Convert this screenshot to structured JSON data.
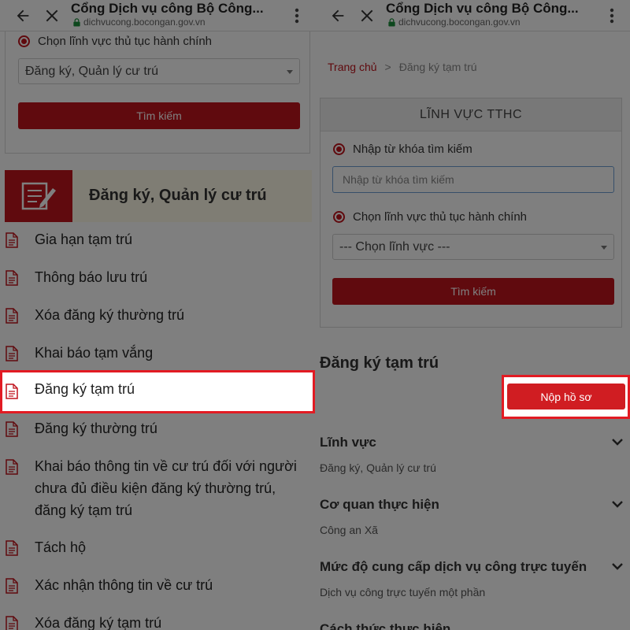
{
  "browser": {
    "title": "Cổng Dịch vụ công Bộ Công...",
    "url": "dichvucong.bocongan.gov.vn"
  },
  "left": {
    "field_radio_label": "Chọn lĩnh vực thủ tục hành chính",
    "field_select_value": "Đăng ký, Quản lý cư trú",
    "search_button": "Tìm kiếm",
    "category_title": "Đăng ký, Quản lý cư trú",
    "procedures": [
      "Gia hạn tạm trú",
      "Thông báo lưu trú",
      "Xóa đăng ký thường trú",
      "Khai báo tạm vắng",
      "Đăng ký tạm trú",
      "Đăng ký thường trú",
      "Khai báo thông tin về cư trú đối với người chưa đủ điều kiện đăng ký thường trú, đăng ký tạm trú",
      "Tách hộ",
      "Xác nhận thông tin về cư trú",
      "Xóa đăng ký tạm trú"
    ],
    "highlighted_index": 4
  },
  "right": {
    "breadcrumb": {
      "home": "Trang chủ",
      "separator": ">",
      "current": "Đăng ký tạm trú"
    },
    "card_title": "LĨNH VỰC TTHC",
    "keyword_radio_label": "Nhập từ khóa tìm kiếm",
    "keyword_placeholder": "Nhập từ khóa tìm kiếm",
    "field_radio_label": "Chọn lĩnh vực thủ tục hành chính",
    "field_select_value": "--- Chọn lĩnh vực ---",
    "search_button": "Tìm kiếm",
    "page_heading": "Đăng ký tạm trú",
    "submit_button": "Nộp hồ sơ",
    "sections": [
      {
        "title": "Lĩnh vực",
        "value": "Đăng ký, Quản lý cư trú"
      },
      {
        "title": "Cơ quan thực hiện",
        "value": "Công an Xã"
      },
      {
        "title": "Mức độ cung cấp dịch vụ công trực tuyến",
        "value": "Dịch vụ công trực tuyến một phần"
      },
      {
        "title": "Cách thức thực hiện",
        "value": ""
      }
    ]
  },
  "colors": {
    "accent": "#c0141d",
    "highlight": "#e21b23",
    "overlay": "#000000"
  },
  "icons": [
    "back-arrow-icon",
    "close-icon",
    "more-vert-icon",
    "lock-icon",
    "document-icon",
    "edit-form-icon",
    "chevron-down-icon"
  ]
}
